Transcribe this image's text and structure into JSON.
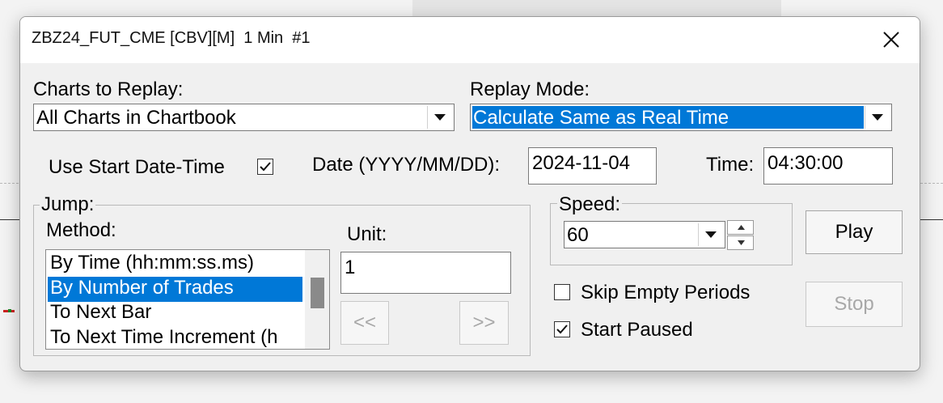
{
  "window": {
    "title": "ZBZ24_FUT_CME [CBV][M]  1 Min  #1"
  },
  "charts_to_replay": {
    "label": "Charts to Replay:",
    "value": "All Charts in Chartbook"
  },
  "replay_mode": {
    "label": "Replay Mode:",
    "value": "Calculate Same as Real Time"
  },
  "start": {
    "use_label": "Use Start Date-Time",
    "use_checked": true,
    "date_label": "Date (YYYY/MM/DD):",
    "date_value": "2024-11-04",
    "time_label": "Time:",
    "time_value": "04:30:00"
  },
  "jump": {
    "group_label": "Jump:",
    "method_label": "Method:",
    "methods": [
      "By Time (hh:mm:ss.ms)",
      "By Number of Trades",
      "To Next Bar",
      "To Next Time Increment (h"
    ],
    "selected_method": "By Number of Trades",
    "unit_label": "Unit:",
    "unit_value": "1",
    "back_label": "<<",
    "forward_label": ">>"
  },
  "speed": {
    "group_label": "Speed:",
    "value": "60"
  },
  "options": {
    "skip_empty_label": "Skip Empty Periods",
    "skip_empty_checked": false,
    "start_paused_label": "Start Paused",
    "start_paused_checked": true
  },
  "buttons": {
    "play": "Play",
    "stop": "Stop"
  },
  "colors": {
    "accent": "#0078d7",
    "dialog_bg": "#f0f0f0",
    "disabled_text": "#a8a8a8"
  }
}
